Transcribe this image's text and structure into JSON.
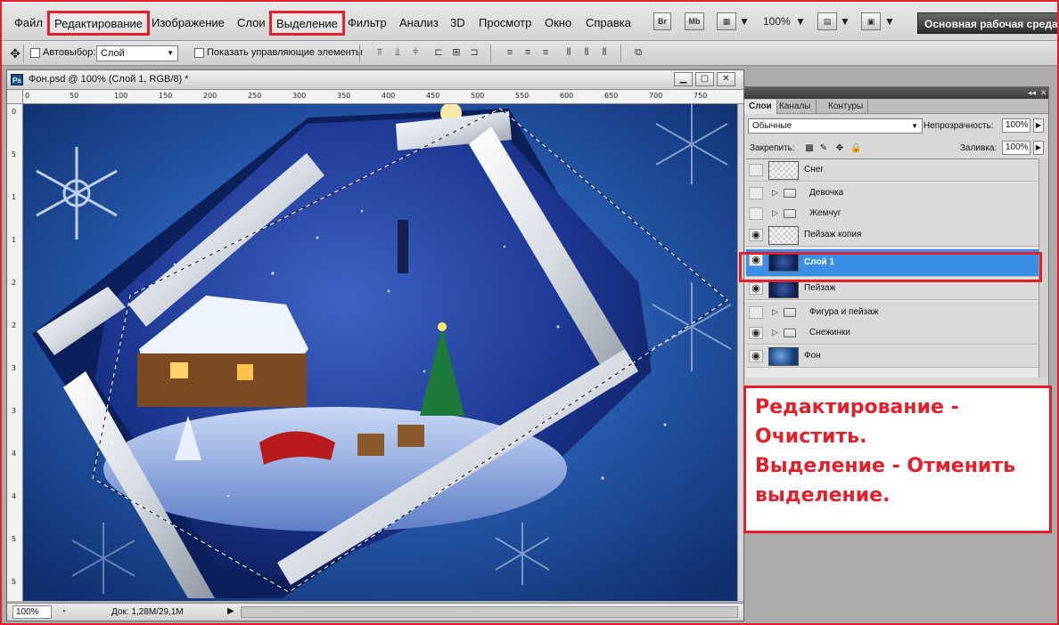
{
  "menu": {
    "file": "Файл",
    "edit": "Редактирование",
    "image": "Изображение",
    "layer": "Слои",
    "select": "Выделение",
    "filter": "Фильтр",
    "analysis": "Анализ",
    "threed": "3D",
    "view": "Просмотр",
    "window": "Окно",
    "help": "Справка",
    "bridge": "Br",
    "minibridge": "Mb",
    "zoom": "100%",
    "workspace": "Основная рабочая среда"
  },
  "options": {
    "autoselect_label": "Автовыбор:",
    "autoselect_value": "Слой",
    "show_controls_label": "Показать управляющие элементы"
  },
  "document": {
    "title": "Фон.psd @ 100% (Слой 1, RGB/8) *",
    "zoom": "100%",
    "doc_size": "Док: 1,28M/29,1M",
    "ruler_h": [
      "0",
      "50",
      "100",
      "150",
      "200",
      "250",
      "300",
      "350",
      "400",
      "450",
      "500",
      "550",
      "600",
      "650",
      "700",
      "750"
    ],
    "ruler_v": [
      "0",
      "5",
      "1",
      "1",
      "2",
      "2",
      "3",
      "3",
      "4",
      "4",
      "5",
      "5"
    ]
  },
  "layers_panel": {
    "tabs": [
      "Слои",
      "Каналы",
      "Контуры"
    ],
    "blend_mode": "Обычные",
    "opacity_label": "Непрозрачность:",
    "opacity_value": "100%",
    "lock_label": "Закрепить:",
    "fill_label": "Заливка:",
    "fill_value": "100%",
    "layers": [
      {
        "name": "Снег",
        "visible": false,
        "type": "layer",
        "thumb": "checker"
      },
      {
        "name": "Девочка",
        "visible": false,
        "type": "group"
      },
      {
        "name": "Жемчуг",
        "visible": false,
        "type": "group"
      },
      {
        "name": "Пейзаж копия",
        "visible": true,
        "type": "layer",
        "thumb": "checker"
      },
      {
        "name": "Слой 1",
        "visible": true,
        "type": "layer",
        "thumb": "dark",
        "selected": true
      },
      {
        "name": "Пейзаж",
        "visible": true,
        "type": "layer",
        "thumb": "dark"
      },
      {
        "name": "Фигура и пейзаж",
        "visible": false,
        "type": "group"
      },
      {
        "name": "Снежинки",
        "visible": true,
        "type": "group"
      },
      {
        "name": "Фон",
        "visible": true,
        "type": "layer",
        "thumb": "photo"
      }
    ]
  },
  "note": {
    "lines": [
      "Редактирование -",
      "Очистить.",
      "Выделение - Отменить",
      "выделение."
    ]
  },
  "colors": {
    "highlight": "#e0202a",
    "selected_layer": "#3b8ee6"
  }
}
